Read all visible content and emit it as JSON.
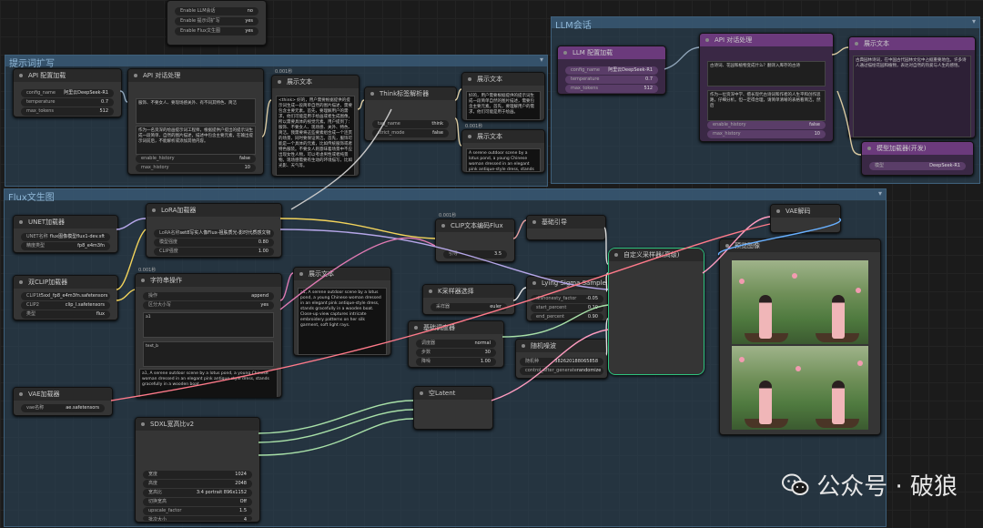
{
  "groups": {
    "prompt_expand": {
      "title": "提示词扩写"
    },
    "llm_chat": {
      "title": "LLM会话"
    },
    "flux_t2i": {
      "title": "Flux文生图"
    }
  },
  "top_panel": {
    "rows": [
      {
        "label": "Enable LLM会话",
        "value": "no"
      },
      {
        "label": "Enable 提示词扩写",
        "value": "yes"
      },
      {
        "label": "Enable Flux文生图",
        "value": "yes"
      }
    ]
  },
  "nodes": {
    "api_config": {
      "title": "API 配置加载",
      "fields": [
        {
          "label": "config_name",
          "value": "阿里云DeepSeek-R1"
        },
        {
          "label": "temperature",
          "value": "0.7"
        },
        {
          "label": "max_tokens",
          "value": "512"
        }
      ]
    },
    "api_chat": {
      "title": "API 对话处理",
      "prompt_text": "服饰、不要女人、要现场感关外、有不同其特色、简洁",
      "system_text": "作为一名资深的绘画提示词工程师，根据提供户提出的提示词生成一段简单、自然的图片描述，描述中包含主要元素，在输出提示词前后，不能解析或添加其他内容。",
      "fields": [
        {
          "label": "enable_history",
          "value": "false"
        },
        {
          "label": "max_history",
          "value": "10"
        }
      ]
    },
    "show_text_1": {
      "title": "展示文本",
      "time": "0.001秒",
      "text": "<think> 好的，用户需要根据提供的提示词生成一段简单自然的图片描述，需要包含主要元素。首先，要理解用户的需求，他们可能是用于绘画或者生成图像，所以需要具体的视觉元素。用户提到了：服饰、不要女人、现场感、关外、特色、简洁。我需要将这些要素组合成一个连贯的场景，同时要保证简洁。首先，服饰可能是一个具体的元素，比如传统服饰或者特色服装。不要女人则意味着场景中不应出现女性人物，可以考虑男性或者纯景物。现场感需要有生动的环境描写，比如光影、天气等。"
    },
    "think_filter": {
      "title": "Think标签解析器",
      "fields": [
        {
          "label": "tag_name",
          "value": "think"
        },
        {
          "label": "strict_mode",
          "value": "false"
        }
      ]
    },
    "show_text_2": {
      "title": "展示文本",
      "text": "好的，用户需要根据提供的提示词生成一段简单自然的图片描述，需要包含主要元素。首先，要理解用户的需求，他们可能是用于绘画。"
    },
    "show_text_3": {
      "title": "展示文本",
      "time": "0.001秒",
      "text": "A serene outdoor scene by a lotus pond, a young Chinese woman dressed in an elegant pink antique-style dress, stands gracefully in a wooden boat."
    },
    "llm_left": {
      "title": "LLM 配置加载",
      "fields": [
        {
          "label": "config_name",
          "value": "阿里云DeepSeek-R1"
        },
        {
          "label": "temperature",
          "value": "0.7"
        },
        {
          "label": "max_tokens",
          "value": "512"
        }
      ]
    },
    "llm_chat_node": {
      "title": "API 对话处理",
      "prompt_text": "古诗词、花园和植物变成什么？翻译入库存的古诗",
      "system_text": "作为一位资深中学、擅长现代古诗词和作者的人生平和创作思路，仔细分析。但一定得合理，请简单清晰的表格看简洁。然后",
      "fields": [
        {
          "label": "enable_history",
          "value": "false"
        },
        {
          "label": "max_history",
          "value": "10"
        }
      ]
    },
    "llm_show": {
      "title": "展示文本",
      "text": "古典园林诗词，在中国古代园林文化中占据重要地位。许多诗人通过描绘花园和植物，表达对自然的热爱与人生的感悟。"
    },
    "llm_small": {
      "title": "模型加载器(开发)",
      "field": {
        "label": "模型",
        "value": "DeepSeek-R1"
      }
    },
    "unet": {
      "title": "UNET加载器",
      "fields": [
        {
          "label": "UNET名称",
          "value": "flux图像模型flux1-dev.sft"
        },
        {
          "label": "精度类型",
          "value": "fp8_e4m3fn"
        }
      ]
    },
    "dual_clip": {
      "title": "双CLIP加载器",
      "fields": [
        {
          "label": "CLIP1",
          "value": "t5xxl_fp8_e4m3fn.safetensors"
        },
        {
          "label": "CLIP2",
          "value": "clip_l.safetensors"
        },
        {
          "label": "类型",
          "value": "flux"
        }
      ]
    },
    "vae_loader": {
      "title": "VAE加载器",
      "fields": [
        {
          "label": "vae名称",
          "value": "ae.safetensors"
        }
      ]
    },
    "lora": {
      "title": "LoRA加载器",
      "fields": [
        {
          "label": "LoRA名称",
          "value": "set8写实人像Flux-祖肤质光-影时代质感文物"
        },
        {
          "label": "模型强度",
          "value": "0.80"
        },
        {
          "label": "CLIP强度",
          "value": "1.00"
        }
      ]
    },
    "string_op": {
      "title": "字符串操作",
      "time": "0.001秒",
      "fields": [
        {
          "label": "操作",
          "value": "append"
        },
        {
          "label": "区分大小写",
          "value": "yes"
        }
      ],
      "box_a": "a1",
      "box_b": "text_b",
      "text": "a1, A serene outdoor scene by a lotus pond, a young Chinese woman dressed in an elegant pink antique-style dress, stands gracefully in a wooden boat."
    },
    "show_text_4": {
      "title": "展示文本",
      "text": "a1, A serene outdoor scene by a lotus pond, a young Chinese woman dressed in an elegant pink antique-style dress, stands gracefully in a wooden boat. Close-up view captures intricate embroidery patterns on her silk garment, soft light rays."
    },
    "clip_encode": {
      "title": "CLIP文本编码Flux",
      "time": "0.001秒",
      "fields": [
        {
          "label": "引导",
          "value": "3.5"
        }
      ]
    },
    "basic_guider": {
      "title": "基础引导"
    },
    "ksampler_select": {
      "title": "K采样器选择",
      "fields": [
        {
          "label": "采样器",
          "value": "euler"
        }
      ]
    },
    "lying_sigma": {
      "title": "Lying Sigma Sampler",
      "fields": [
        {
          "label": "dishonesty_factor",
          "value": "-0.05"
        },
        {
          "label": "start_percent",
          "value": "0.10"
        },
        {
          "label": "end_percent",
          "value": "0.90"
        }
      ]
    },
    "basic_scheduler": {
      "title": "基础调度器",
      "fields": [
        {
          "label": "调度器",
          "value": "normal"
        },
        {
          "label": "步数",
          "value": "30"
        },
        {
          "label": "降噪",
          "value": "1.00"
        }
      ]
    },
    "random_noise": {
      "title": "随机噪波",
      "fields": [
        {
          "label": "随机种",
          "value": "382620188065858"
        },
        {
          "label": "control_after_generate",
          "value": "randomize"
        }
      ]
    },
    "custom_sampler": {
      "title": "自定义采样器(高级)"
    },
    "vae_decode": {
      "title": "VAE解码"
    },
    "preview": {
      "title": "预览图像"
    },
    "empty_latent": {
      "title": "空Latent"
    },
    "sdxl_res": {
      "title": "SDXL宽高比v2",
      "fields": [
        {
          "label": "宽度",
          "value": "1024"
        },
        {
          "label": "高度",
          "value": "2048"
        },
        {
          "label": "宽高比",
          "value": "3:4 portrait 896x1152"
        },
        {
          "label": "切换宽高",
          "value": "Off"
        },
        {
          "label": "upscale_factor",
          "value": "1.5"
        },
        {
          "label": "批次大小",
          "value": "4"
        }
      ]
    }
  },
  "watermark": {
    "text": "公众号 · 破狼"
  },
  "colors": {
    "accent_green": "#2ec27e",
    "group_blue": "#3e5f7a",
    "llm_purple": "#6b3a7c"
  }
}
